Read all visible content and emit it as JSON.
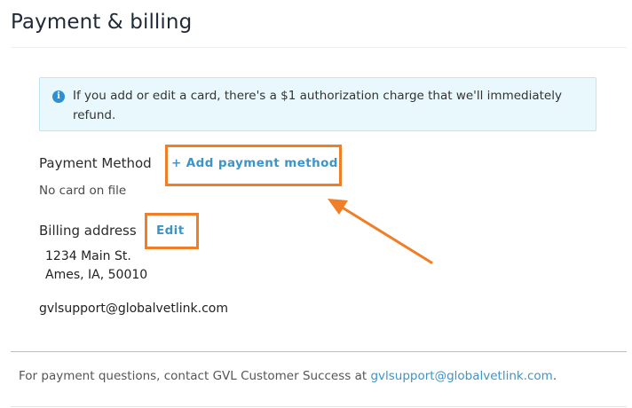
{
  "page": {
    "title": "Payment & billing"
  },
  "info_banner": {
    "icon": "info-icon",
    "text": "If you add or edit a card, there's a $1 authorization charge that we'll immediately refund."
  },
  "payment_method": {
    "label": "Payment Method",
    "add_link": "+ Add payment method",
    "empty_text": "No card on file"
  },
  "billing_address": {
    "label": "Billing address",
    "edit_link": "Edit",
    "line1": "1234 Main St.",
    "line2": "Ames, IA, 50010",
    "email": "gvlsupport@globalvetlink.com"
  },
  "footer": {
    "text": "For payment questions, contact GVL Customer Success at ",
    "email_link": "gvlsupport@globalvetlink.com",
    "suffix": "."
  },
  "annotation": {
    "color": "#f07e26"
  },
  "colors": {
    "link": "#3b95c9",
    "banner_bg": "#e8f8fc",
    "banner_border": "#bfe7f2",
    "info_icon": "#2f8fd0"
  }
}
